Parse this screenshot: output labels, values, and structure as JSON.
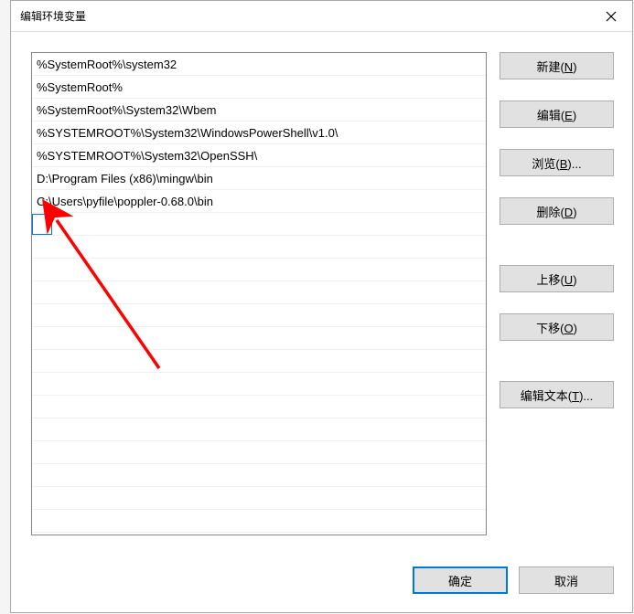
{
  "dialog": {
    "title": "编辑环境变量"
  },
  "list": {
    "entries": [
      "%SystemRoot%\\system32",
      "%SystemRoot%",
      "%SystemRoot%\\System32\\Wbem",
      "%SYSTEMROOT%\\System32\\WindowsPowerShell\\v1.0\\",
      "%SYSTEMROOT%\\System32\\OpenSSH\\",
      "D:\\Program Files (x86)\\mingw\\bin",
      "C:\\Users\\pyfile\\poppler-0.68.0\\bin"
    ]
  },
  "buttons": {
    "new": "新建(N)",
    "edit": "编辑(E)",
    "browse": "浏览(B)...",
    "delete": "删除(D)",
    "moveup": "上移(U)",
    "movedown": "下移(O)",
    "edittext": "编辑文本(T)...",
    "ok": "确定",
    "cancel": "取消"
  }
}
